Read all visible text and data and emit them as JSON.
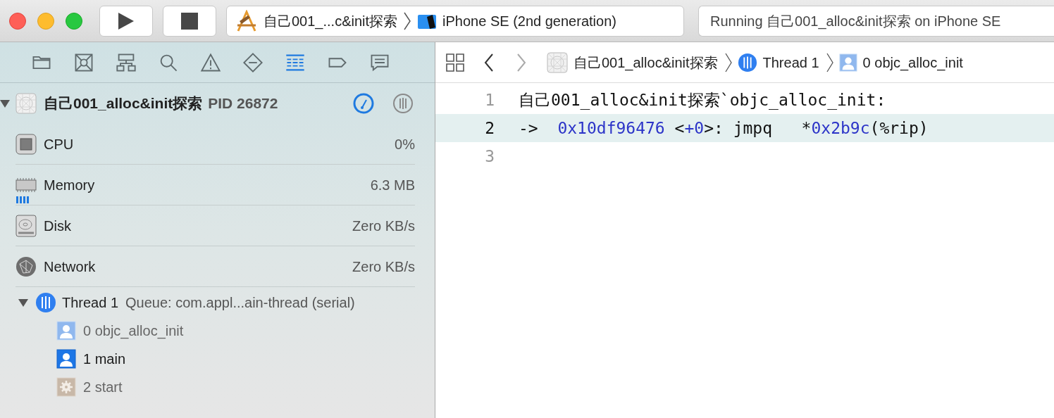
{
  "toolbar": {
    "scheme": "自己001_...c&init探索",
    "device": "iPhone SE (2nd generation)",
    "status": "Running 自己001_alloc&init探索 on iPhone SE"
  },
  "navigator_tabs": [
    {
      "kind": "folder",
      "selected": false
    },
    {
      "kind": "source-control",
      "selected": false
    },
    {
      "kind": "hierarchy",
      "selected": false
    },
    {
      "kind": "search",
      "selected": false
    },
    {
      "kind": "warning",
      "selected": false
    },
    {
      "kind": "breakpoint",
      "selected": false
    },
    {
      "kind": "debug",
      "selected": true
    },
    {
      "kind": "tag",
      "selected": false
    },
    {
      "kind": "report",
      "selected": false
    }
  ],
  "process": {
    "name": "自己001_alloc&init探索",
    "pid": "PID 26872",
    "expanded": true
  },
  "gauges": [
    {
      "kind": "cpu",
      "name": "CPU",
      "value": "0%"
    },
    {
      "kind": "memory",
      "name": "Memory",
      "value": "6.3 MB"
    },
    {
      "kind": "disk",
      "name": "Disk",
      "value": "Zero KB/s"
    },
    {
      "kind": "network",
      "name": "Network",
      "value": "Zero KB/s"
    }
  ],
  "thread": {
    "name": "Thread 1",
    "queue": "Queue: com.appl...ain-thread (serial)",
    "expanded": true,
    "frames": [
      {
        "kind": "user",
        "label": "0 objc_alloc_init",
        "dimmed": true
      },
      {
        "kind": "user",
        "label": "1 main",
        "dimmed": false
      },
      {
        "kind": "system",
        "label": "2 start",
        "dimmed": true
      }
    ]
  },
  "jump_bar": [
    {
      "kind": "project",
      "label": "自己001_alloc&init探索"
    },
    {
      "kind": "thread",
      "label": "Thread 1"
    },
    {
      "kind": "frame",
      "label": "0 objc_alloc_init"
    }
  ],
  "code_lines": [
    {
      "number": "1",
      "current": false,
      "segments": [
        {
          "kind": "plain",
          "text": "自己001_alloc&init探索`objc_alloc_init:"
        }
      ]
    },
    {
      "number": "2",
      "current": true,
      "segments": [
        {
          "kind": "plain",
          "text": "->  "
        },
        {
          "kind": "number",
          "text": "0x10df96476"
        },
        {
          "kind": "plain",
          "text": " <"
        },
        {
          "kind": "number",
          "text": "+0"
        },
        {
          "kind": "plain",
          "text": ">: jmpq   *"
        },
        {
          "kind": "number",
          "text": "0x2b9c"
        },
        {
          "kind": "plain",
          "text": "(%rip)"
        }
      ]
    },
    {
      "number": "3",
      "current": false
    }
  ]
}
